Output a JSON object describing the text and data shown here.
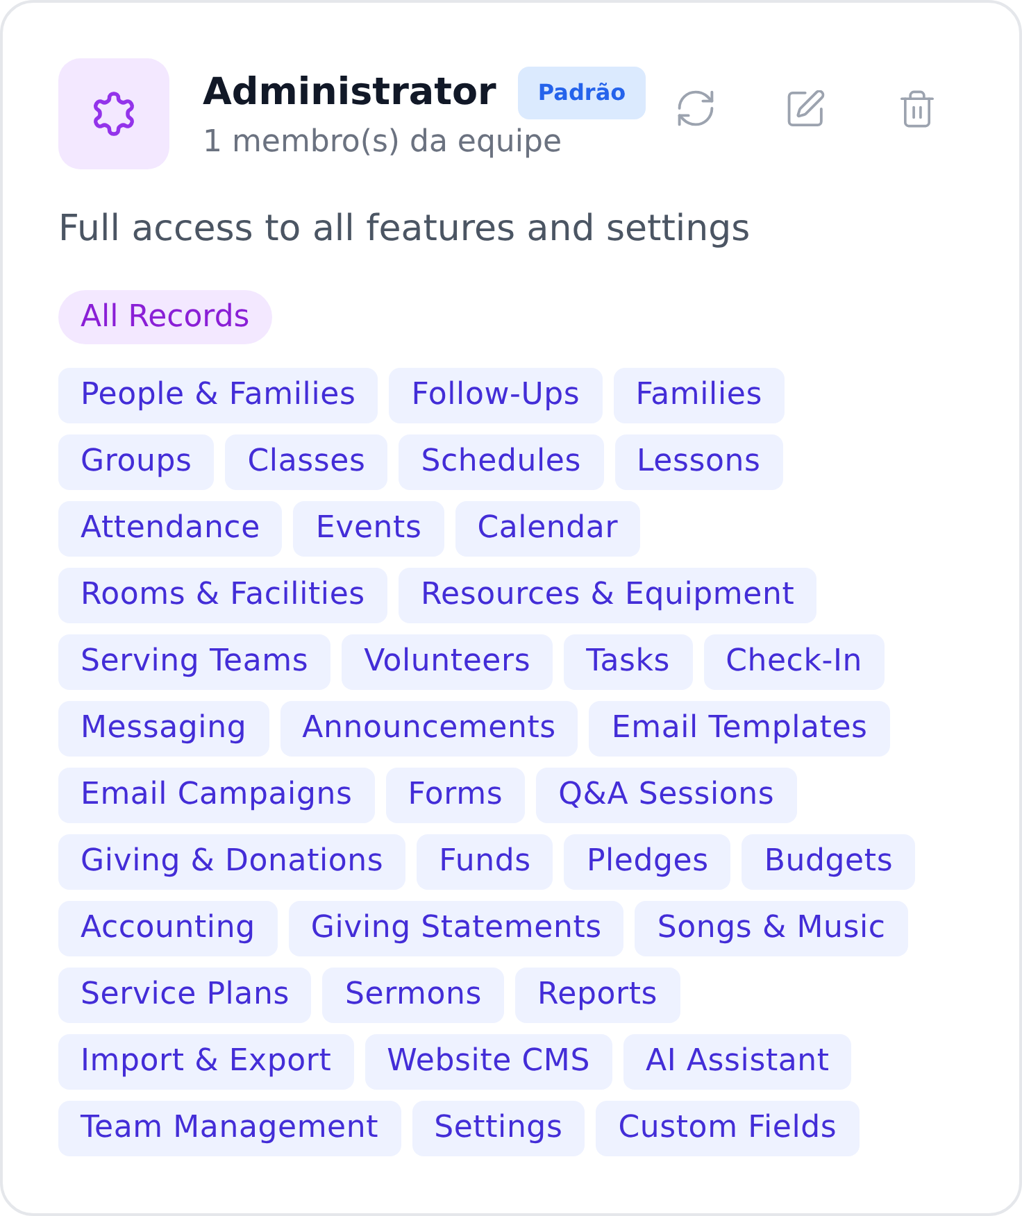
{
  "role": {
    "name": "Administrator",
    "badge": "Padrão",
    "member_count": "1 membro(s) da equipe",
    "description": "Full access to all features and settings",
    "access_scope": "All Records",
    "permission_rows": [
      [
        "People & Families",
        "Follow-Ups",
        "Families"
      ],
      [
        "Groups",
        "Classes",
        "Schedules",
        "Lessons"
      ],
      [
        "Attendance",
        "Events",
        "Calendar"
      ],
      [
        "Rooms & Facilities",
        "Resources & Equipment"
      ],
      [
        "Serving Teams",
        "Volunteers",
        "Tasks",
        "Check-In"
      ],
      [
        "Messaging",
        "Announcements",
        "Email Templates"
      ],
      [
        "Email Campaigns",
        "Forms",
        "Q&A Sessions"
      ],
      [
        "Giving & Donations",
        "Funds",
        "Pledges",
        "Budgets"
      ],
      [
        "Accounting",
        "Giving Statements",
        "Songs & Music"
      ],
      [
        "Service Plans",
        "Sermons",
        "Reports"
      ],
      [
        "Import & Export",
        "Website CMS",
        "AI Assistant"
      ],
      [
        "Team Management",
        "Settings",
        "Custom Fields"
      ]
    ]
  }
}
